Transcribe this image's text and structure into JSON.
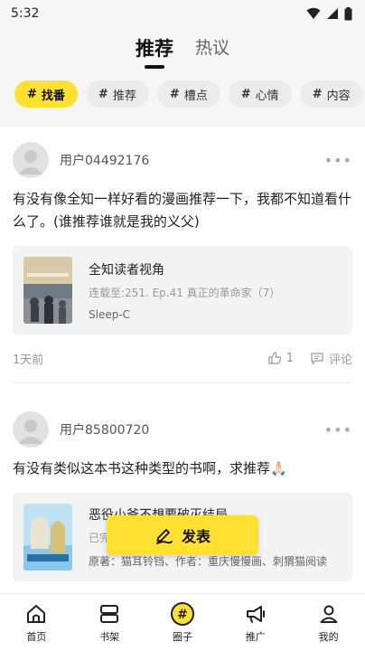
{
  "status_bar": {
    "time": "5:32"
  },
  "top_tabs": [
    {
      "label": "推荐",
      "active": true
    },
    {
      "label": "热议",
      "active": false
    }
  ],
  "chips": [
    {
      "hash": "#",
      "label": "找番",
      "active": true
    },
    {
      "hash": "#",
      "label": "推荐",
      "active": false
    },
    {
      "hash": "#",
      "label": "槽点",
      "active": false
    },
    {
      "hash": "#",
      "label": "心情",
      "active": false
    },
    {
      "hash": "#",
      "label": "内容",
      "active": false
    }
  ],
  "posts": [
    {
      "username": "用户04492176",
      "text": "有没有像全知一样好看的漫画推荐一下，我都不知道看什么了。(谁推荐谁就是我的义父)",
      "book": {
        "title": "全知读者视角",
        "meta": "连载至:251. Ep.41 真正的革命家（7）",
        "extra": "Sleep-C"
      },
      "time": "1天前",
      "likes": "1",
      "comment_label": "评论"
    },
    {
      "username": "用户85800720",
      "text": "有没有类似这本书这种类型的书啊，求推荐🙏🏻",
      "book": {
        "title": "恶役小爷不想要破灭结局",
        "meta": "已完结",
        "extra": "原著：猫耳铃铛、作者：重庆慢慢画、刺猬猫阅读"
      }
    }
  ],
  "more_label": "•••",
  "fab": {
    "label": "发表"
  },
  "bottom_nav": [
    {
      "label": "首页",
      "icon": "home-icon"
    },
    {
      "label": "书架",
      "icon": "bookshelf-icon"
    },
    {
      "label": "圈子",
      "icon": "circle-hash-icon",
      "active": true
    },
    {
      "label": "推广",
      "icon": "megaphone-icon"
    },
    {
      "label": "我的",
      "icon": "profile-icon"
    }
  ],
  "colors": {
    "accent": "#ffe033",
    "background": "#f6f6f6"
  }
}
